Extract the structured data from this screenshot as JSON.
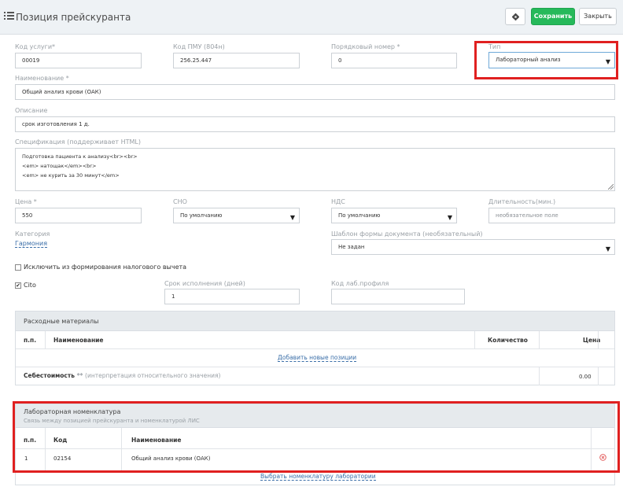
{
  "header": {
    "title": "Позиция прейскуранта",
    "save_label": "Сохранить",
    "close_label": "Закрыть"
  },
  "form": {
    "service_code": {
      "label": "Код услуги*",
      "value": "00019"
    },
    "pmu_code": {
      "label": "Код ПМУ (804н)",
      "value": "256.25.447"
    },
    "order_number": {
      "label": "Порядковый номер *",
      "value": "0"
    },
    "type": {
      "label": "Тип",
      "value": "Лабораторный анализ"
    },
    "name": {
      "label": "Наименование *",
      "value": "Общий анализ крови (ОАК)"
    },
    "description": {
      "label": "Описание",
      "value": "срок изготовления   1 д."
    },
    "specification": {
      "label": "Спецификация (поддерживает HTML)",
      "lines": [
        "Подготовка пациента к анализу<br><br>",
        "<em>  натощак</em><br>",
        "<em>  не курить за 30 минут</em>"
      ]
    },
    "price": {
      "label": "Цена *",
      "value": "550"
    },
    "sno": {
      "label": "СНО",
      "value": "По умолчанию"
    },
    "nds": {
      "label": "НДС",
      "value": "По умолчанию"
    },
    "duration": {
      "label": "Длительность(мин.)",
      "placeholder": "необязательное поле"
    },
    "category": {
      "label": "Категория",
      "value": "Гармония"
    },
    "doc_template": {
      "label": "Шаблон формы документа (необязательный)",
      "value": "Не задан"
    },
    "exclude_tax": {
      "label": "Исключить из формирования налогового вычета",
      "checked": false
    },
    "cito": {
      "label": "Cito",
      "checked": true
    },
    "exec_days": {
      "label": "Срок исполнения (дней)",
      "value": "1"
    },
    "lab_profile": {
      "label": "Код лаб.профиля",
      "value": ""
    }
  },
  "materials": {
    "title": "Расходные материалы",
    "columns": [
      "п.п.",
      "Наименование",
      "Количество",
      "Цена"
    ],
    "add_link": "Добавить новые позиции",
    "cost_label": "Себестоимость",
    "cost_mark": "**",
    "cost_note": "(интерпретация относительного значения)",
    "cost_value": "0.00"
  },
  "lab_nomenclature": {
    "title": "Лабораторная номенклатура",
    "subtitle": "Связь между позицией прейскуранта и номенклатурой ЛИС",
    "columns": [
      "п.п.",
      "Код",
      "Наименование"
    ],
    "rows": [
      {
        "num": "1",
        "code": "02154",
        "name": "Общий анализ крови (ОАК)"
      }
    ],
    "select_link": "Выбрать номенклатуру лаборатории"
  },
  "colors": {
    "save_button": "#26b95a",
    "highlight": "#e02020",
    "link": "#3a6ea8",
    "remove_icon": "#e05050"
  }
}
